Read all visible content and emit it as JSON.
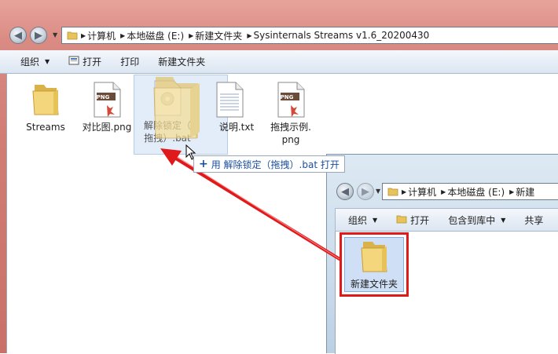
{
  "main_window": {
    "breadcrumb": [
      "计算机",
      "本地磁盘 (E:)",
      "新建文件夹",
      "Sysinternals Streams v1.6_20200430"
    ],
    "toolbar": {
      "organize": "组织",
      "open": "打开",
      "print": "打印",
      "new_folder": "新建文件夹"
    },
    "files": [
      {
        "name": "Streams",
        "type": "folder"
      },
      {
        "name": "对比图.png",
        "type": "png"
      },
      {
        "name": "解除锁定（拖拽）.bat",
        "type": "bat"
      },
      {
        "name": "说明.txt",
        "type": "txt"
      },
      {
        "name": "拖拽示例.png",
        "type": "png"
      }
    ],
    "bat_label_line1": "解除锁定（",
    "bat_label_line2": "拖拽）.bat",
    "example_label_line1": "拖拽示例.",
    "example_label_line2": "png",
    "png_badge": "PNG"
  },
  "drag_tooltip": "用 解除锁定（拖拽）.bat 打开",
  "second_window": {
    "breadcrumb": [
      "计算机",
      "本地磁盘 (E:)",
      "新建"
    ],
    "toolbar": {
      "organize": "组织",
      "open": "打开",
      "include_in_library": "包含到库中",
      "share": "共享"
    },
    "selected_folder": "新建文件夹"
  },
  "colors": {
    "highlight_border": "#e0191b",
    "arrow": "#e0191b",
    "folder": "#f2d277"
  }
}
